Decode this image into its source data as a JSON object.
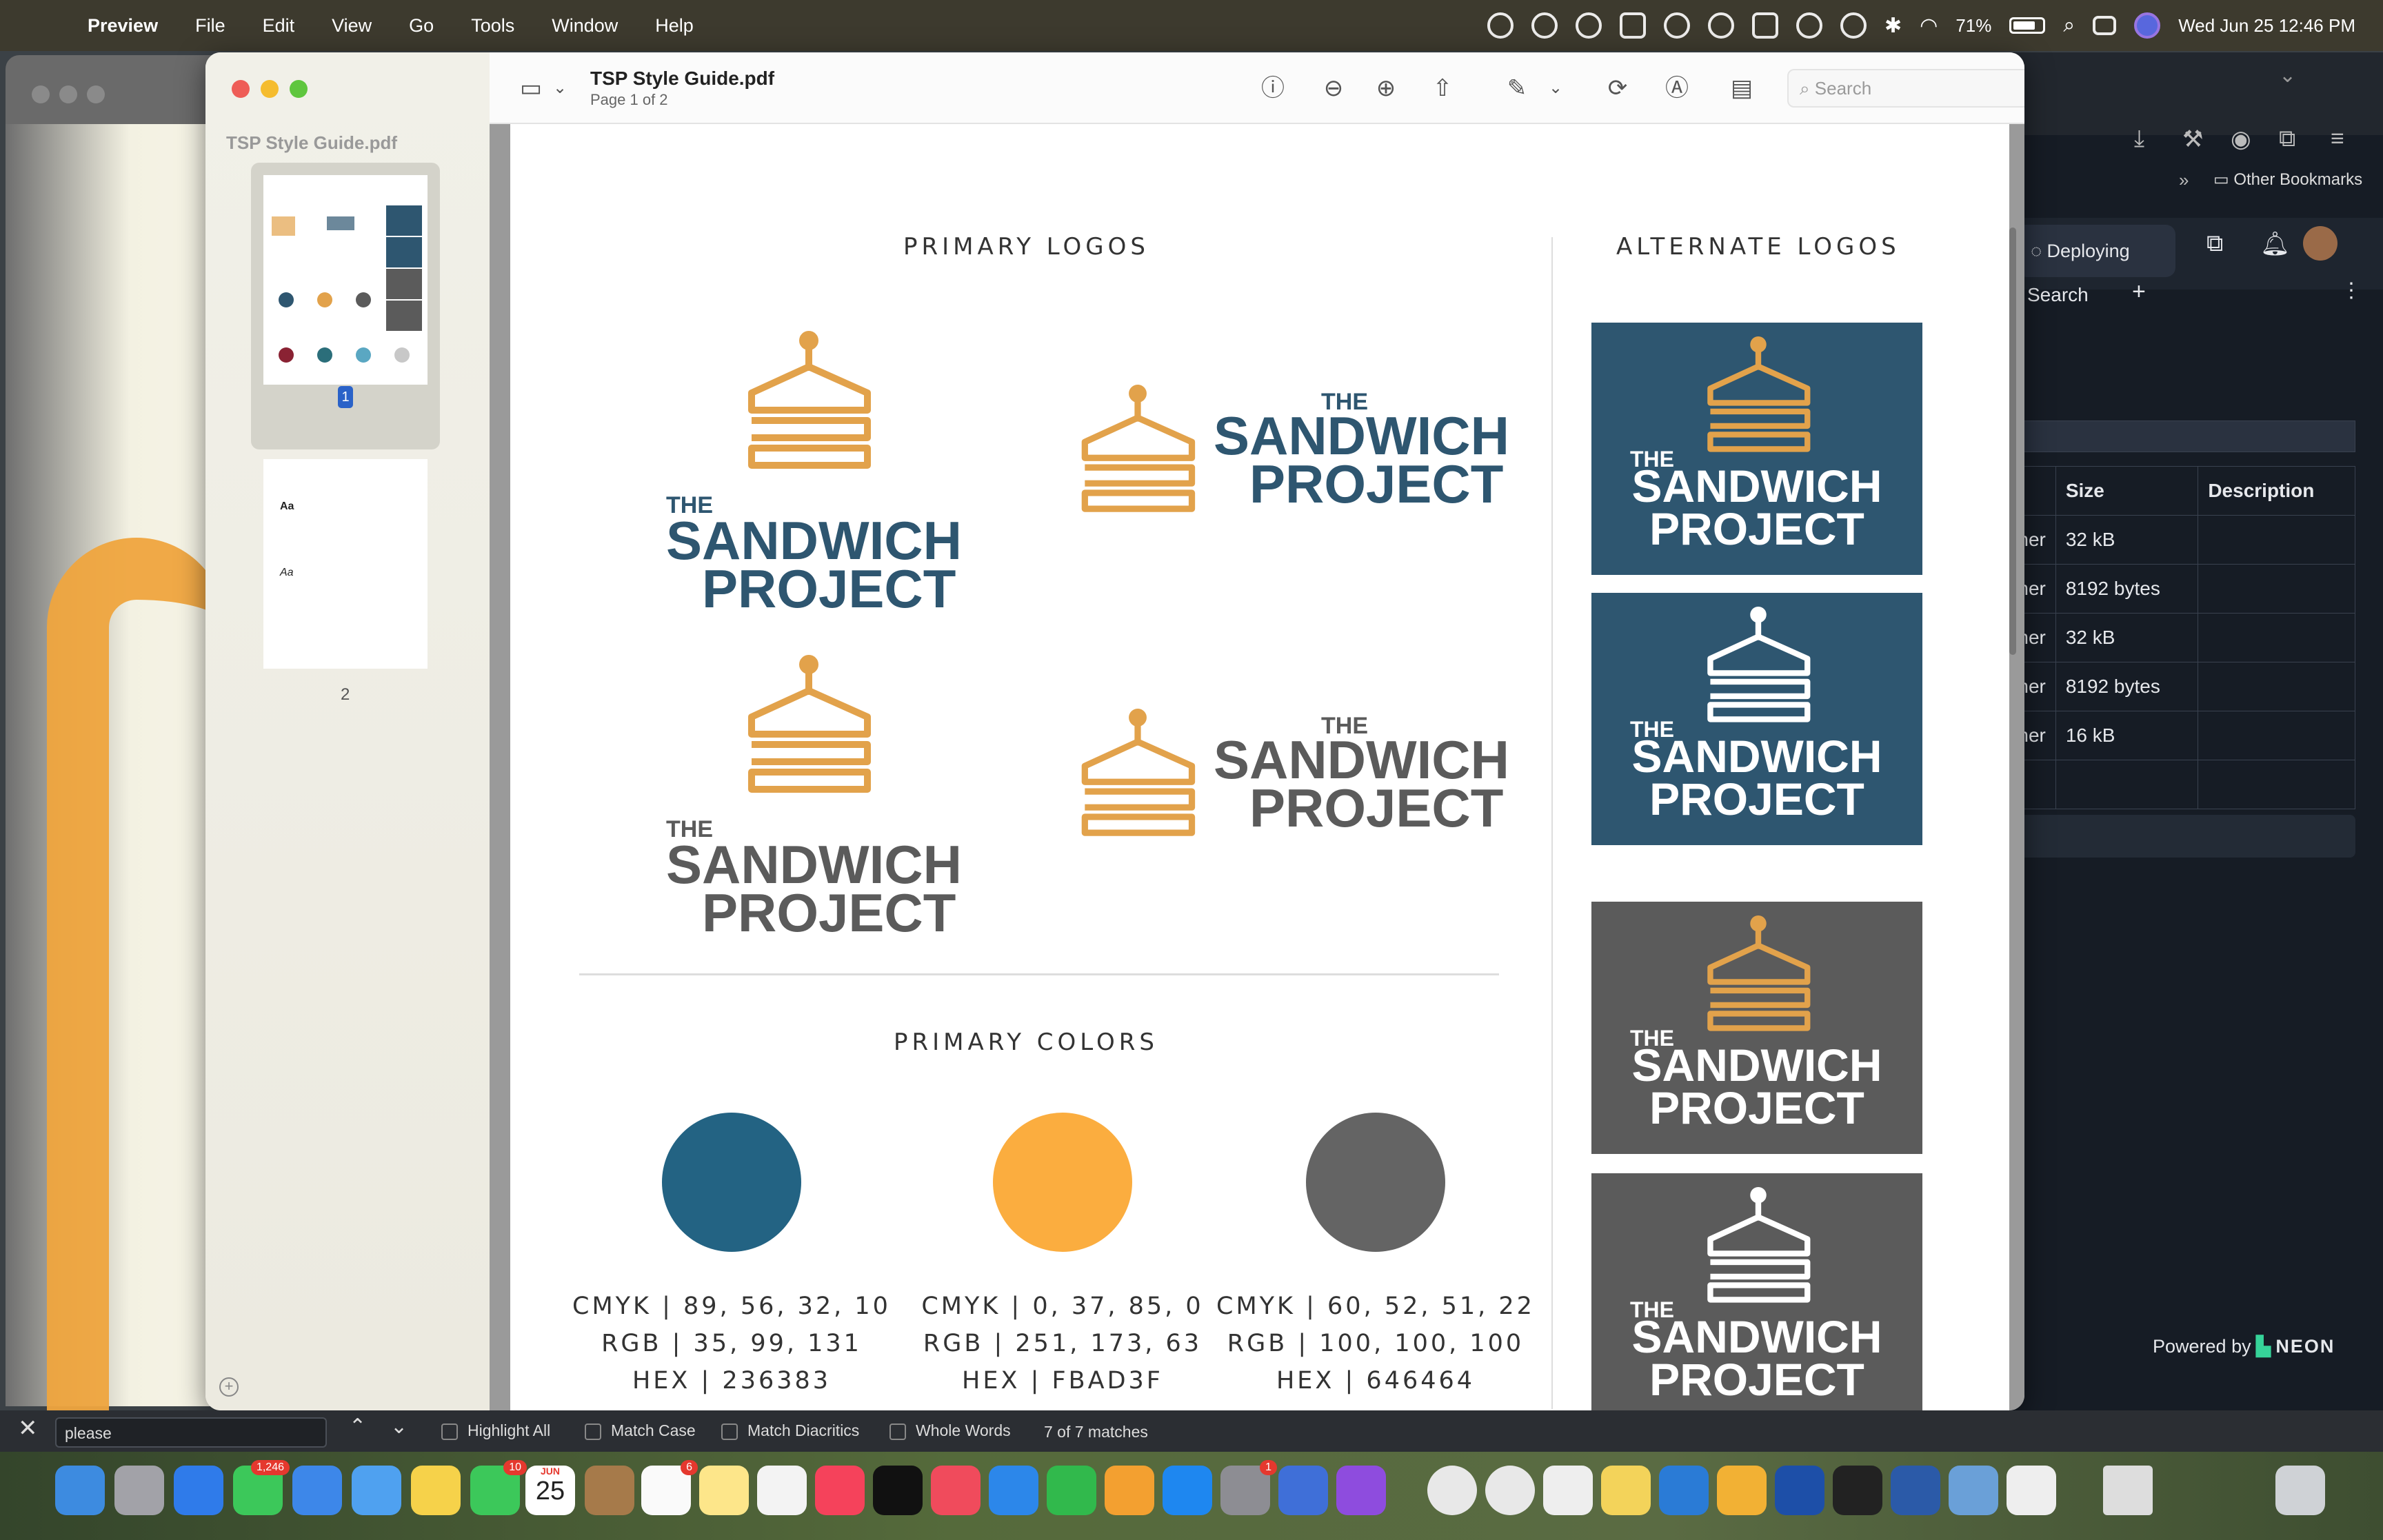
{
  "menubar": {
    "app": "Preview",
    "items": [
      "File",
      "Edit",
      "View",
      "Go",
      "Tools",
      "Window",
      "Help"
    ],
    "battery": "71%",
    "datetime": "Wed Jun 25  12:46 PM"
  },
  "preview": {
    "sidebar_title": "TSP Style Guide.pdf",
    "thumb1_label": "1",
    "thumb2_label": "2",
    "doc_title": "TSP Style Guide.pdf",
    "doc_subtitle": "Page 1 of 2",
    "search_placeholder": "Search"
  },
  "page": {
    "primary_logos_heading": "PRIMARY LOGOS",
    "alternate_logos_heading": "ALTERNATE LOGOS",
    "primary_colors_heading": "PRIMARY COLORS",
    "logo_the": "THE",
    "logo_sandwich": "SANDWICH",
    "logo_project": "PROJECT",
    "colors": [
      {
        "hex_value": "#236383",
        "cmyk": "CMYK | 89, 56, 32, 10",
        "rgb": "RGB | 35, 99, 131",
        "hex": "HEX | 236383"
      },
      {
        "hex_value": "#FBAD3F",
        "cmyk": "CMYK | 0, 37, 85, 0",
        "rgb": "RGB | 251, 173, 63",
        "hex": "HEX | FBAD3F"
      },
      {
        "hex_value": "#646464",
        "cmyk": "CMYK | 60, 52, 51, 22",
        "rgb": "RGB | 100, 100, 100",
        "hex": "HEX | 646464"
      }
    ],
    "brand": {
      "blue": "#2e5670",
      "orange": "#e2a24b",
      "gray": "#5b5b5b"
    }
  },
  "browser": {
    "bookmarks": "Other Bookmarks",
    "deploying": "Deploying",
    "search": "Search",
    "table_headers": [
      "Size",
      "Description"
    ],
    "rows": [
      {
        "owner": "_owner",
        "size": "32 kB"
      },
      {
        "owner": "_owner",
        "size": "8192 bytes"
      },
      {
        "owner": "_owner",
        "size": "32 kB"
      },
      {
        "owner": "_owner",
        "size": "8192 bytes"
      },
      {
        "owner": "_owner",
        "size": "16 kB"
      }
    ],
    "powered_by": "Powered by",
    "neon": "NEON"
  },
  "findbar": {
    "query": "please",
    "highlight_all": "Highlight All",
    "match_case": "Match Case",
    "match_diacritics": "Match Diacritics",
    "whole_words": "Whole Words",
    "matches": "7 of 7 matches"
  },
  "dock": {
    "messages_badge": "1,246",
    "facetime_badge": "10",
    "calendar_month": "JUN",
    "calendar_day": "25",
    "reminders_badge": "6",
    "settings_badge": "1"
  }
}
